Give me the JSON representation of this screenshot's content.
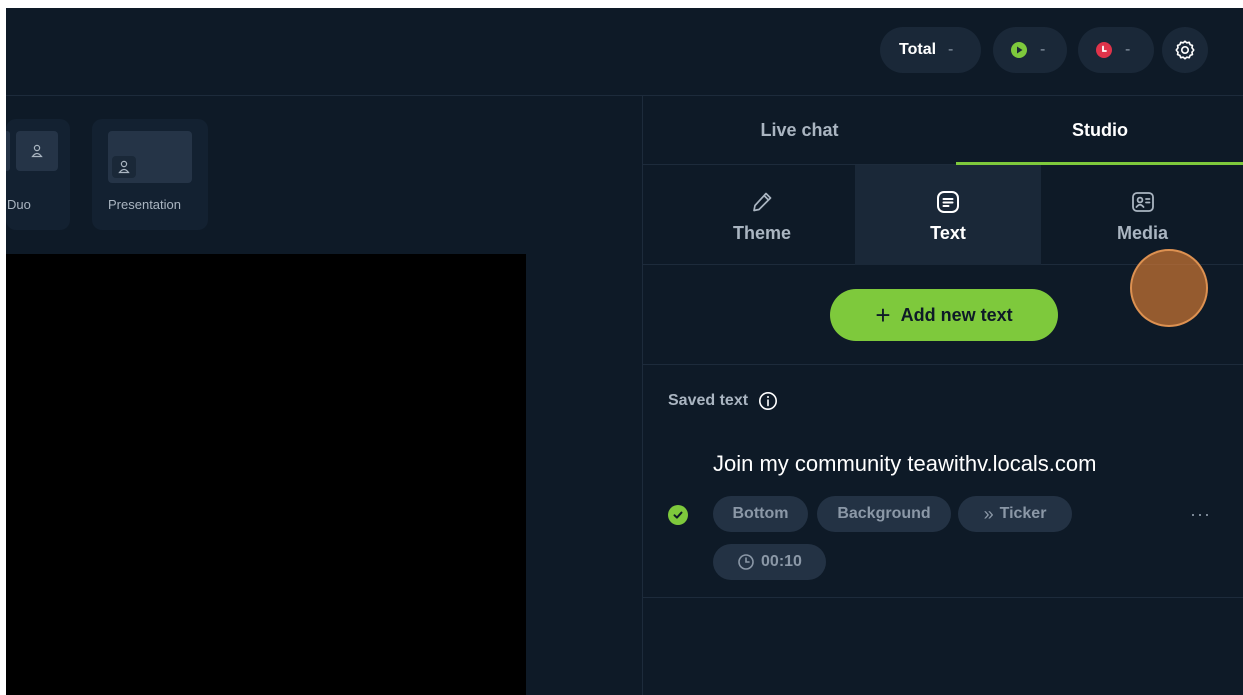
{
  "topbar": {
    "total": {
      "label": "Total",
      "value": "-"
    },
    "youtube": {
      "icon": "youtube-play-icon",
      "value": "-",
      "color": "#7ec93c"
    },
    "recording": {
      "icon": "record-icon",
      "value": "-",
      "color": "#e0334a"
    },
    "settings": {
      "icon": "gear-icon"
    }
  },
  "layouts": [
    {
      "label": "Duo"
    },
    {
      "label": "Presentation"
    }
  ],
  "panel": {
    "tabs": [
      {
        "label": "Live chat",
        "active": false
      },
      {
        "label": "Studio",
        "active": true
      }
    ],
    "subtabs": [
      {
        "label": "Theme",
        "icon": "pencil-icon",
        "active": false
      },
      {
        "label": "Text",
        "icon": "text-box-icon",
        "active": true
      },
      {
        "label": "Media",
        "icon": "media-card-icon",
        "active": false
      }
    ],
    "add_button": "Add new text",
    "saved": {
      "title": "Saved text",
      "items": [
        {
          "text": "Join my community teawithv.locals.com",
          "selected": true,
          "tags": [
            "Bottom",
            "Background",
            "Ticker"
          ],
          "duration": "00:10"
        }
      ]
    }
  },
  "colors": {
    "accent": "#7ec93c",
    "background": "#0e1a27",
    "cursor_highlight": "#d67a34"
  }
}
